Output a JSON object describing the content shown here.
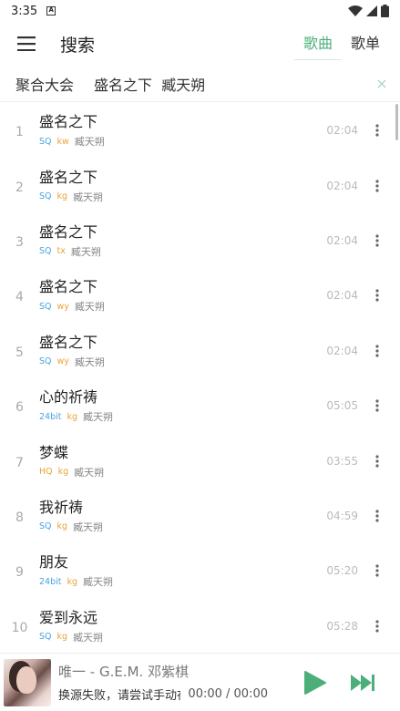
{
  "status_bar": {
    "time": "3:35",
    "notification_glyph": "A",
    "icons": [
      "wifi-icon",
      "signal-icon",
      "battery-icon"
    ]
  },
  "app_bar": {
    "title": "搜索",
    "tabs": [
      {
        "label": "歌曲",
        "active": true
      },
      {
        "label": "歌单",
        "active": false
      }
    ]
  },
  "search_row": {
    "source": "聚合大会",
    "query": "盛名之下  臧天朔"
  },
  "songs": [
    {
      "index": "1",
      "name": "盛名之下",
      "quality": "SQ",
      "source": "kw",
      "singer": "臧天朔",
      "duration": "02:04"
    },
    {
      "index": "2",
      "name": "盛名之下",
      "quality": "SQ",
      "source": "kg",
      "singer": "臧天朔",
      "duration": "02:04"
    },
    {
      "index": "3",
      "name": "盛名之下",
      "quality": "SQ",
      "source": "tx",
      "singer": "臧天朔",
      "duration": "02:04"
    },
    {
      "index": "4",
      "name": "盛名之下",
      "quality": "SQ",
      "source": "wy",
      "singer": "臧天朔",
      "duration": "02:04"
    },
    {
      "index": "5",
      "name": "盛名之下",
      "quality": "SQ",
      "source": "wy",
      "singer": "臧天朔",
      "duration": "02:04"
    },
    {
      "index": "6",
      "name": "心的祈祷",
      "quality": "24bit",
      "source": "kg",
      "singer": "臧天朔",
      "duration": "05:05"
    },
    {
      "index": "7",
      "name": "梦蝶",
      "quality": "HQ",
      "source": "kg",
      "singer": "臧天朔",
      "duration": "03:55"
    },
    {
      "index": "8",
      "name": "我祈祷",
      "quality": "SQ",
      "source": "kg",
      "singer": "臧天朔",
      "duration": "04:59"
    },
    {
      "index": "9",
      "name": "朋友",
      "quality": "24bit",
      "source": "kg",
      "singer": "臧天朔",
      "duration": "05:20"
    },
    {
      "index": "10",
      "name": "爱到永远",
      "quality": "SQ",
      "source": "kg",
      "singer": "臧天朔",
      "duration": "05:28"
    }
  ],
  "player": {
    "now_playing": "唯一 - G.E.M. 邓紫棋",
    "status": "换源失败，请尝试手动在搜...",
    "time": "00:00 / 00:00"
  },
  "colors": {
    "accent": "#4caf7a",
    "quality_blue": "#4aa3df",
    "source_orange": "#e8a33b"
  }
}
